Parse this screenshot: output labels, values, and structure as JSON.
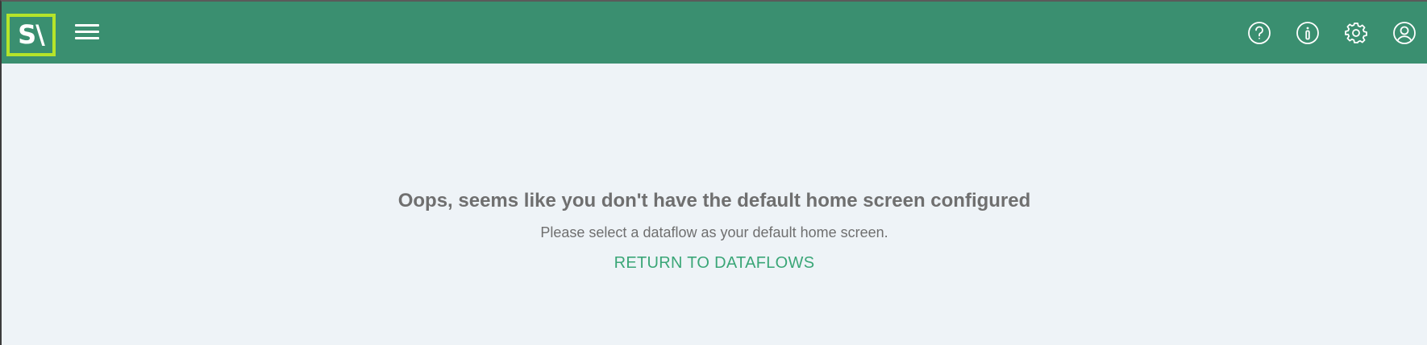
{
  "header": {
    "logo_text": "S\\",
    "menu_icon": "hamburger-menu-icon",
    "icons": [
      "help-icon",
      "info-icon",
      "settings-gear-icon",
      "user-account-icon"
    ]
  },
  "main": {
    "headline": "Oops, seems like you don't have the default home screen configured",
    "subtext": "Please select a dataflow as your default home screen.",
    "return_link": "RETURN TO DATAFLOWS"
  },
  "colors": {
    "header_bg": "#3a8f70",
    "logo_border": "#b5e42a",
    "page_bg": "#eef3f7",
    "text_gray": "#6f6f6f",
    "link_green": "#3aa677"
  }
}
